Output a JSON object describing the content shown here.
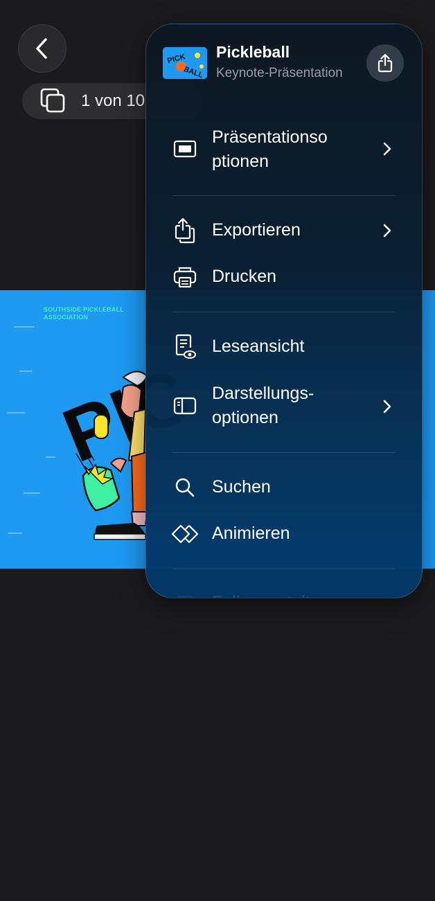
{
  "toolbar": {
    "back_icon": "chevron-left-icon",
    "slide_counter": "1 von 10",
    "slides_icon": "slides-stack-icon"
  },
  "slide": {
    "association_text": "SOUTHSIDE PICKLEBALL ASSOCIATION",
    "big_text": "PIC",
    "background": "#1e9af3",
    "accent": "#3ef0b6"
  },
  "menu": {
    "title": "Pickleball",
    "subtitle": "Keynote-Präsentation",
    "share_icon": "share-icon",
    "items": [
      {
        "label": "Präsentationsoptionen",
        "line1": "Präsentationso",
        "line2": "ptionen",
        "icon": "presentation-screen-icon",
        "chevron": true
      },
      {
        "label": "Exportieren",
        "icon": "export-share-icon",
        "chevron": true
      },
      {
        "label": "Drucken",
        "icon": "printer-icon",
        "chevron": false
      },
      {
        "label": "Leseansicht",
        "icon": "reading-view-icon",
        "chevron": false
      },
      {
        "label": "Darstellungsoptionen",
        "line1": "Darstellungs-",
        "line2": "optionen",
        "icon": "sidebar-view-icon",
        "chevron": true
      },
      {
        "label": "Suchen",
        "icon": "magnifier-icon",
        "chevron": false
      },
      {
        "label": "Animieren",
        "icon": "animate-diamonds-icon",
        "chevron": false
      },
      {
        "label": "Foliengestaltung",
        "icon": "layers-icon",
        "chevron": false
      }
    ]
  }
}
